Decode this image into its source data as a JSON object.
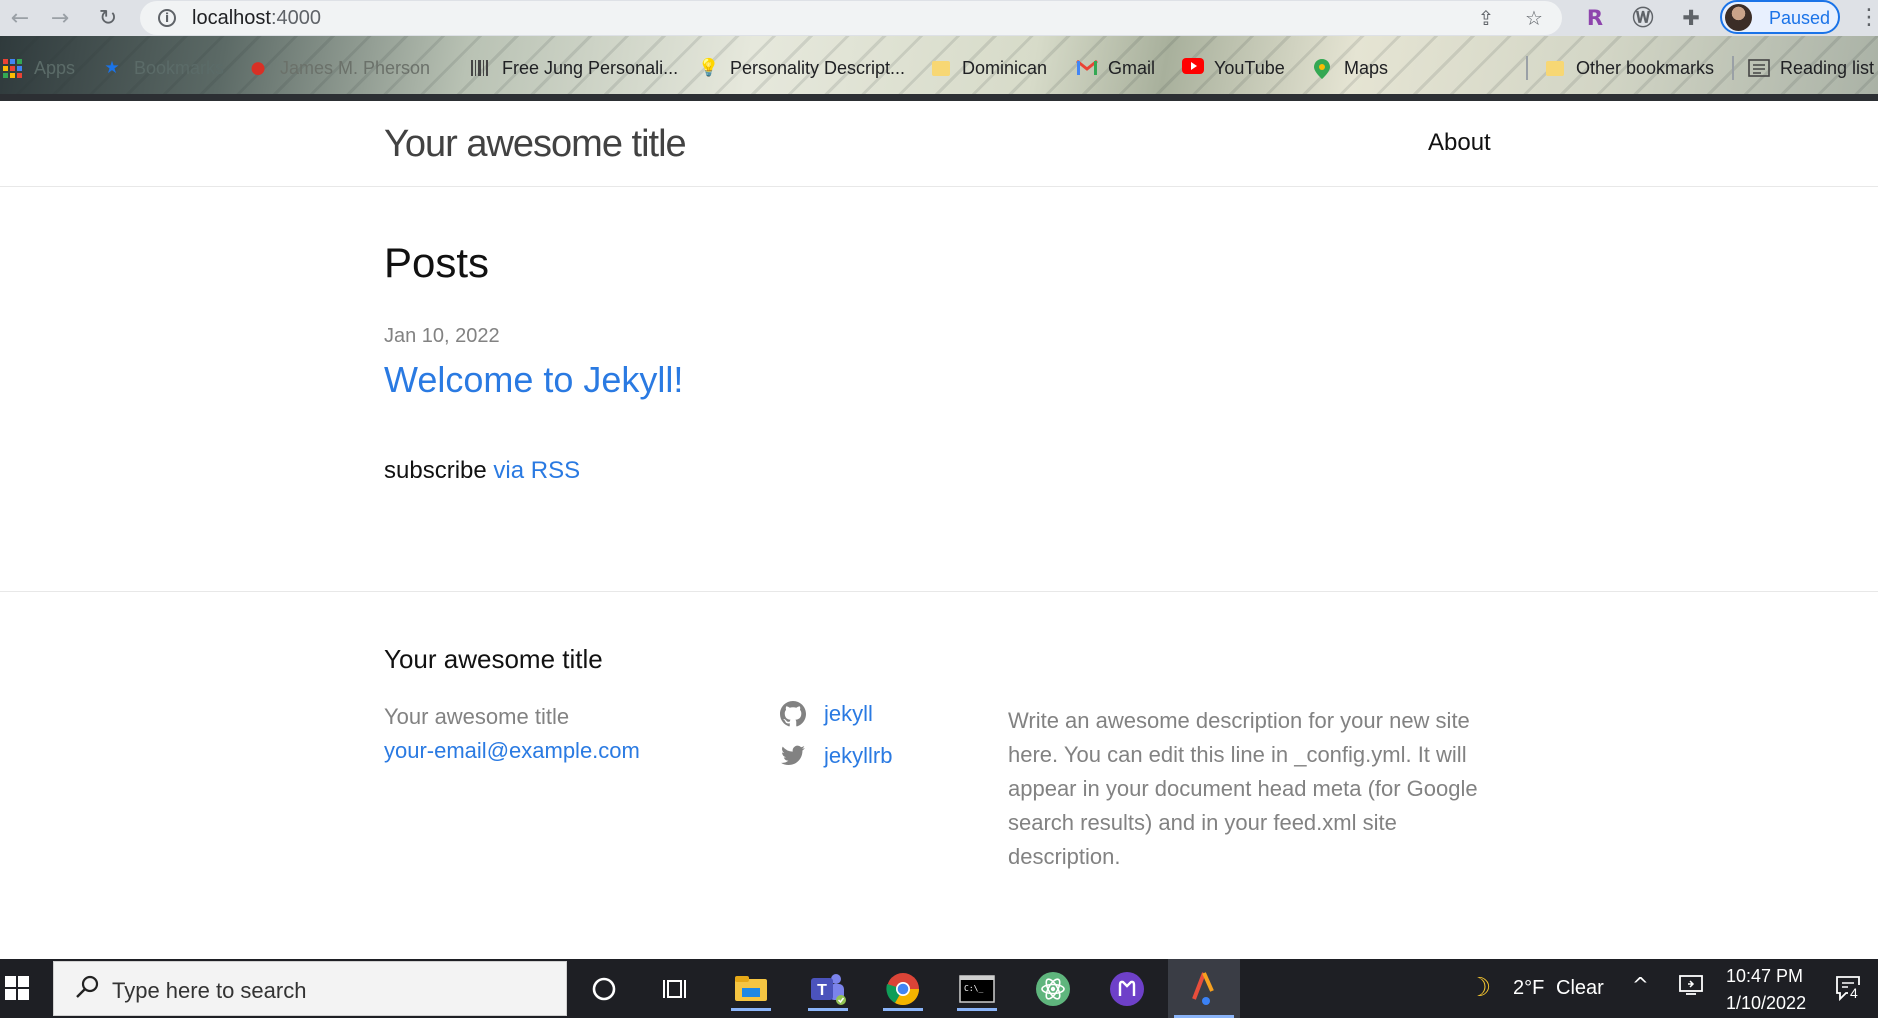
{
  "browser": {
    "url_host": "localhost",
    "url_port": ":4000",
    "profile_label": "Paused",
    "bookmarks": [
      {
        "label": "Apps",
        "icon": "apps-grid-icon"
      },
      {
        "label": "Bookmarks",
        "icon": "star-icon"
      },
      {
        "label": "James M. Pherson",
        "icon": "apple-icon"
      },
      {
        "label": "Free Jung Personali...",
        "icon": "barcode-icon"
      },
      {
        "label": "Personality Descript...",
        "icon": "lightbulb-icon"
      },
      {
        "label": "Dominican",
        "icon": "folder-icon"
      },
      {
        "label": "Gmail",
        "icon": "gmail-icon"
      },
      {
        "label": "YouTube",
        "icon": "youtube-icon"
      },
      {
        "label": "Maps",
        "icon": "maps-pin-icon"
      },
      {
        "label": "Other bookmarks",
        "icon": "folder-icon"
      },
      {
        "label": "Reading list",
        "icon": "reading-list-icon"
      }
    ]
  },
  "site": {
    "title": "Your awesome title",
    "nav": {
      "about": "About"
    }
  },
  "main": {
    "heading": "Posts",
    "posts": [
      {
        "date": "Jan 10, 2022",
        "title": "Welcome to Jekyll!"
      }
    ],
    "subscribe_prefix": "subscribe",
    "subscribe_link": "via RSS"
  },
  "footer": {
    "heading": "Your awesome title",
    "name": "Your awesome title",
    "email": "your-email@example.com",
    "github_username": "jekyll",
    "twitter_username": "jekyllrb",
    "description": "Write an awesome description for your new site here. You can edit this line in _config.yml. It will appear in your document head meta (for Google search results) and in your feed.xml site description."
  },
  "taskbar": {
    "search_placeholder": "Type here to search",
    "weather_temp": "2°F",
    "weather_text": "Clear",
    "time": "10:47 PM",
    "date": "1/10/2022",
    "notification_count": "4"
  },
  "colors": {
    "link": "#2a7ae2",
    "muted_text": "#828282",
    "taskbar_bg": "#1e1f24",
    "profile_accent": "#1a73e8"
  }
}
